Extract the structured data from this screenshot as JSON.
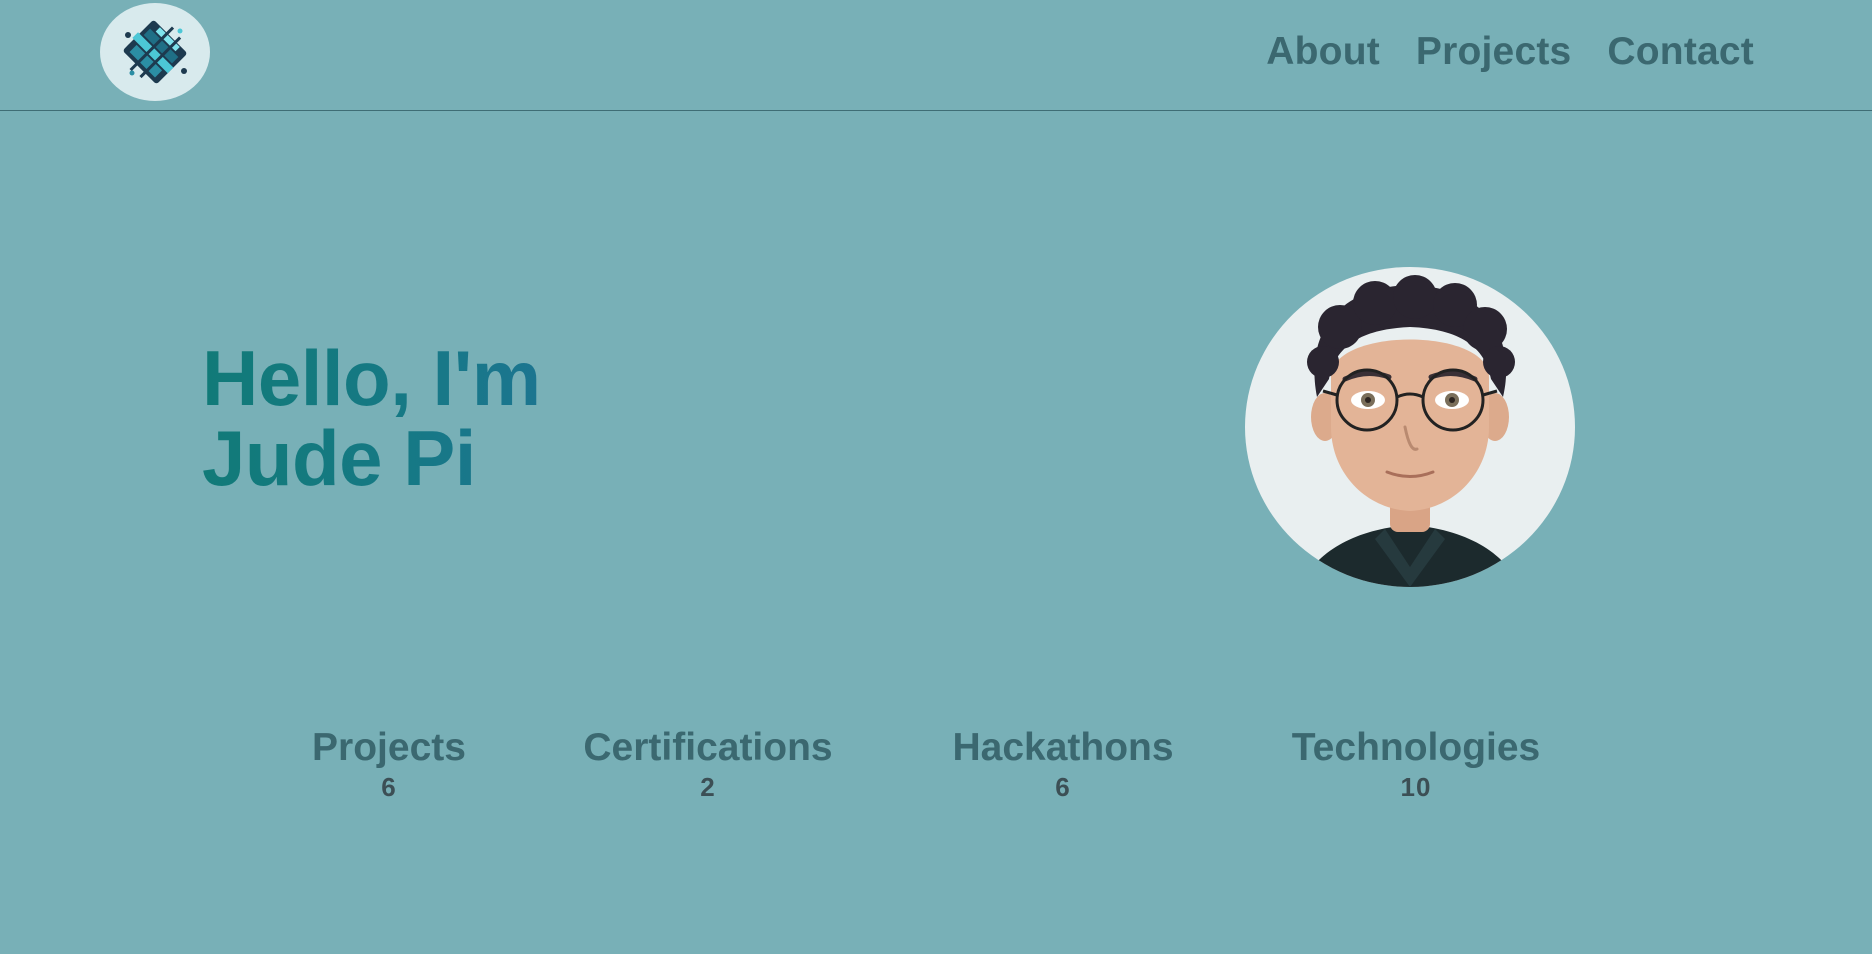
{
  "header": {
    "nav": [
      {
        "label": "About"
      },
      {
        "label": "Projects"
      },
      {
        "label": "Contact"
      }
    ]
  },
  "hero": {
    "line1": "Hello, I'm",
    "line2": "Jude Pi"
  },
  "stats": [
    {
      "label": "Projects",
      "value": "6"
    },
    {
      "label": "Certifications",
      "value": "2"
    },
    {
      "label": "Hackathons",
      "value": "6"
    },
    {
      "label": "Technologies",
      "value": "10"
    }
  ],
  "colors": {
    "background": "#78b0b7",
    "nav_text": "#3b6870",
    "title_gradient_start": "#117a78",
    "title_gradient_end": "#1c7590",
    "stat_value": "#3c4f55"
  },
  "icons": {
    "logo": "geometric-circuit-logo",
    "avatar": "cartoon-portrait-avatar"
  }
}
